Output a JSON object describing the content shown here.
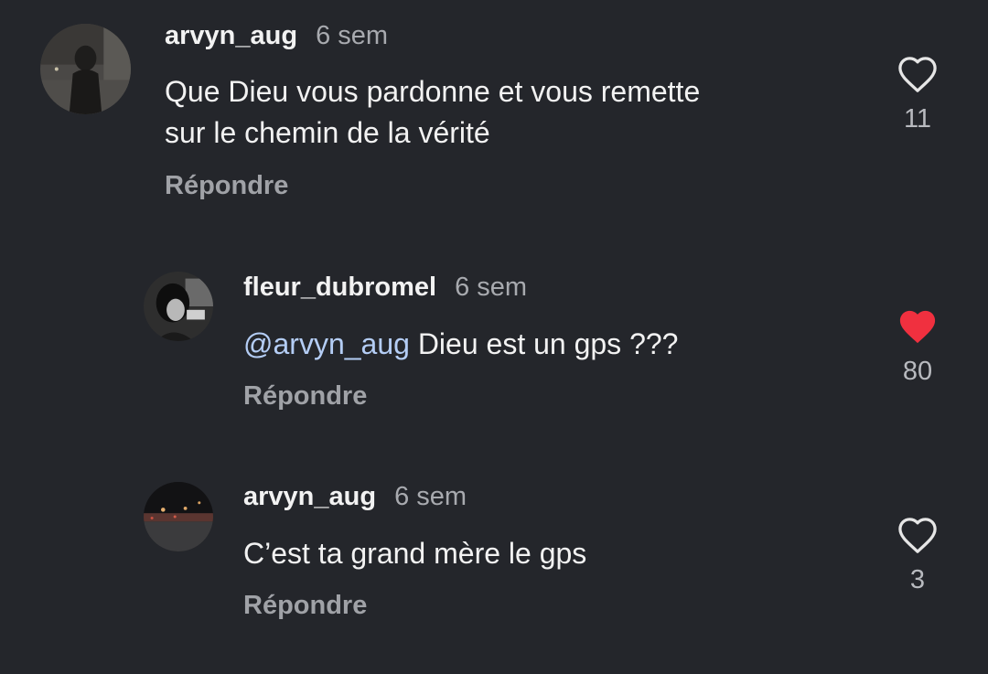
{
  "comments": [
    {
      "username": "arvyn_aug",
      "time": "6 sem",
      "text_line1": "Que Dieu vous pardonne et vous remette",
      "text_line2": "sur le chemin de la vérité",
      "reply_label": "Répondre",
      "likes": "11",
      "liked": false
    },
    {
      "username": "fleur_dubromel",
      "time": "6 sem",
      "mention": "@arvyn_aug",
      "text": " Dieu est un gps ???",
      "reply_label": "Répondre",
      "likes": "80",
      "liked": true
    },
    {
      "username": "arvyn_aug",
      "time": "6 sem",
      "text": "C’est ta grand mère le gps",
      "reply_label": "Répondre",
      "likes": "3",
      "liked": false
    }
  ],
  "icons": {
    "like_outline": "heart-outline-icon",
    "like_filled": "heart-filled-icon"
  },
  "colors": {
    "background": "#24262b",
    "liked_heart": "#f0303f",
    "mention": "#b4cdf5",
    "secondary_text": "#a8aaaf"
  }
}
